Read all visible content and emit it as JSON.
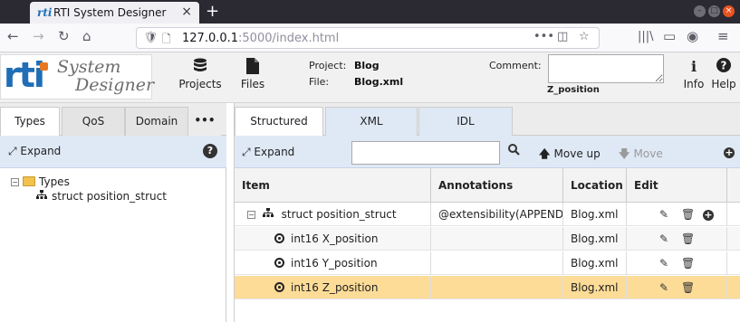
{
  "browser": {
    "tab_title": "RTI System Designer",
    "tab_icon_text": "rti",
    "url_host": "127.0.0.1",
    "url_path": ":5000/index.html"
  },
  "header": {
    "logo_rti": "rti",
    "logo_line1": "System",
    "logo_line2": "Designer",
    "projects_label": "Projects",
    "files_label": "Files",
    "project_key": "Project:",
    "project_value": "Blog",
    "file_key": "File:",
    "file_value": "Blog.xml",
    "comment_label": "Comment:",
    "comment_value": "",
    "selected_name": "Z_position",
    "info_label": "Info",
    "help_label": "Help"
  },
  "left_panel": {
    "tabs": [
      "Types",
      "QoS",
      "Domain",
      "•••"
    ],
    "active_tab": "Types",
    "expand_label": "Expand",
    "tree": {
      "root": "Types",
      "child": "struct position_struct"
    }
  },
  "right_panel": {
    "tabs": [
      "Structured",
      "XML",
      "IDL"
    ],
    "active_tab": "Structured",
    "toolbar": {
      "expand_label": "Expand",
      "search_value": "",
      "search_placeholder": "",
      "move_up_label": "Move up",
      "move_label": "Move"
    },
    "columns": [
      "Item",
      "Annotations",
      "Location",
      "Edit"
    ],
    "rows": [
      {
        "item": "struct position_struct",
        "annotations": "@extensibility(APPENDABLE)",
        "location": "Blog.xml",
        "kind": "struct"
      },
      {
        "item": "int16 X_position",
        "annotations": "",
        "location": "Blog.xml",
        "kind": "member"
      },
      {
        "item": "int16 Y_position",
        "annotations": "",
        "location": "Blog.xml",
        "kind": "member"
      },
      {
        "item": "int16 Z_position",
        "annotations": "",
        "location": "Blog.xml",
        "kind": "member",
        "selected": true
      }
    ]
  },
  "colors": {
    "accent_blue": "#1f6eb6",
    "toolbar_bg": "#dfe9f5",
    "selected_row": "#fddc97",
    "browser_dark": "#2b2a33"
  }
}
